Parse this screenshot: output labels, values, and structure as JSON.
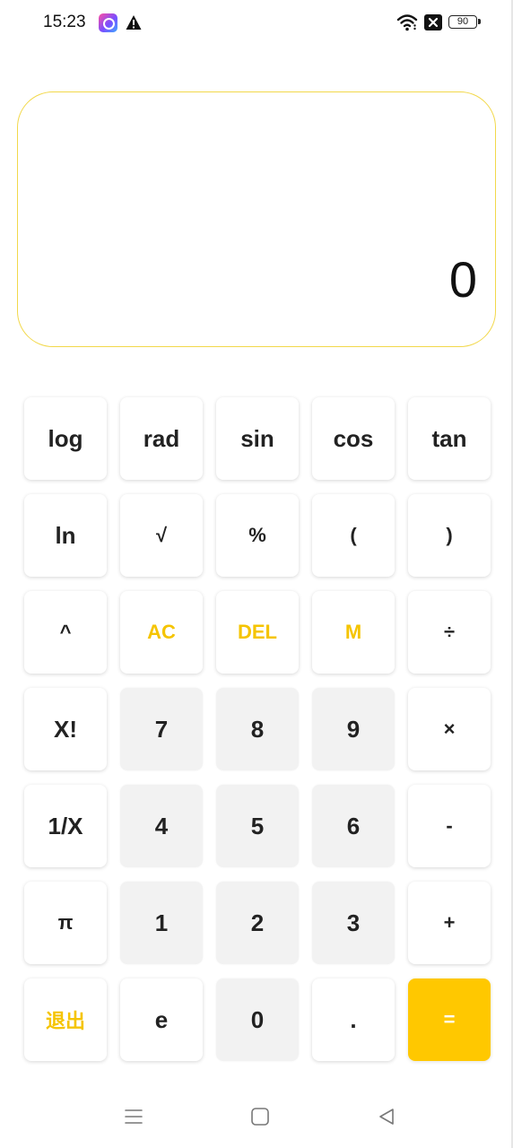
{
  "status_bar": {
    "time": "15:23",
    "battery": "90",
    "icons": [
      "app-notification-icon",
      "warning-icon",
      "wifi-icon",
      "no-sim-icon",
      "battery-icon"
    ]
  },
  "display": {
    "value": "0",
    "border_color": "#f2d84a"
  },
  "keys": {
    "log": "log",
    "rad": "rad",
    "sin": "sin",
    "cos": "cos",
    "tan": "tan",
    "ln": "ln",
    "sqrt": "√",
    "percent": "%",
    "lparen": "(",
    "rparen": ")",
    "pow": "^",
    "ac": "AC",
    "del": "DEL",
    "m": "M",
    "divide": "÷",
    "fact": "X!",
    "d7": "7",
    "d8": "8",
    "d9": "9",
    "multiply": "×",
    "recip": "1/X",
    "d4": "4",
    "d5": "5",
    "d6": "6",
    "minus": "-",
    "pi": "π",
    "d1": "1",
    "d2": "2",
    "d3": "3",
    "plus": "+",
    "exit": "退出",
    "e": "e",
    "d0": "0",
    "dot": ".",
    "equals": "="
  },
  "colors": {
    "accent": "#f5c400",
    "equals_bg": "#ffc800",
    "digit_bg": "#f2f2f2"
  },
  "nav_bar": {
    "icons": [
      "menu-icon",
      "home-icon",
      "back-icon"
    ]
  }
}
